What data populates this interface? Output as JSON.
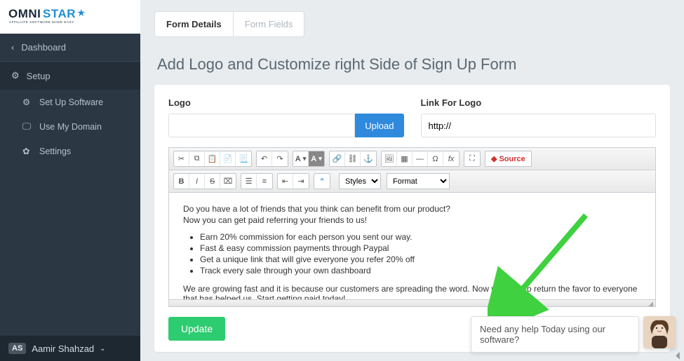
{
  "logo": {
    "brand_main": "OMNI",
    "brand_accent": "STAR",
    "tagline": "AFFILIATE SOFTWARE MADE EASY"
  },
  "sidebar": {
    "dashboard": "Dashboard",
    "setup": "Setup",
    "items": [
      {
        "label": "Set Up Software"
      },
      {
        "label": "Use My Domain"
      },
      {
        "label": "Settings"
      }
    ],
    "user": {
      "initials": "AS",
      "name": "Aamir Shahzad"
    }
  },
  "tabs": [
    {
      "label": "Form Details",
      "active": true
    },
    {
      "label": "Form Fields",
      "active": false
    }
  ],
  "page_title": "Add Logo and Customize right Side of Sign Up Form",
  "fields": {
    "logo_label": "Logo",
    "upload": "Upload",
    "link_label": "Link For Logo",
    "link_value": "http://"
  },
  "toolbar": {
    "styles_label": "Styles",
    "format_label": "Format",
    "source_label": "Source"
  },
  "editor": {
    "p1": "Do you have a lot of friends that you think can benefit from our product?",
    "p2": "Now you can get paid referring your friends to us!",
    "bullets": [
      "Earn 20% commission for each person you sent our way.",
      "Fast & easy commission payments through Paypal",
      "Get a unique link that will give everyone you refer 20% off",
      "Track every sale through your own dashboard"
    ],
    "p3": "We are growing fast and it is because our customers are spreading the word. Now we want to return the favor to everyone that has helped us. Start getting paid today!"
  },
  "buttons": {
    "update": "Update"
  },
  "chat": {
    "text": "Need any help Today using our software?"
  },
  "colors": {
    "accent_blue": "#2f8ade",
    "green": "#2ecc71",
    "arrow": "#3fd13f"
  }
}
